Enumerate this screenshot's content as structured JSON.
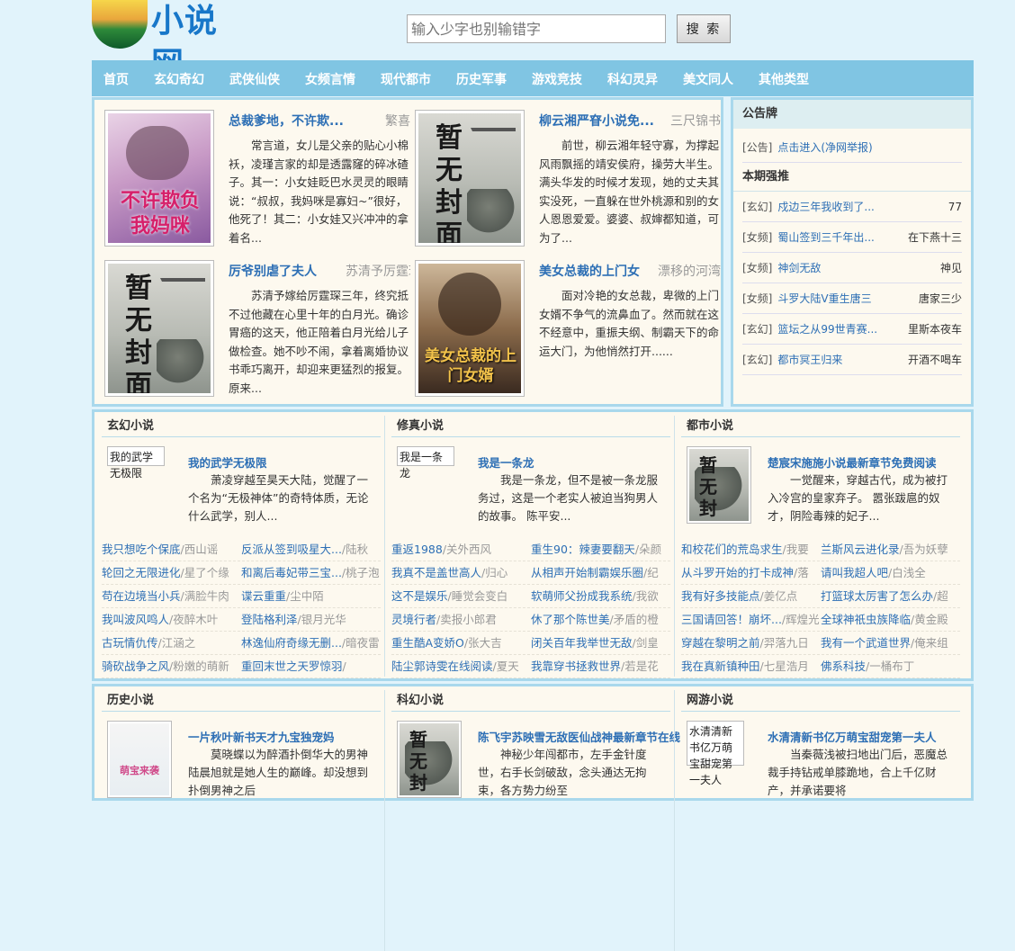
{
  "site": {
    "logo_text": "小说网"
  },
  "search": {
    "placeholder": "输入少字也别输错字",
    "button_label": "搜 索"
  },
  "nav": [
    "首页",
    "玄幻奇幻",
    "武侠仙侠",
    "女频言情",
    "现代都市",
    "历史军事",
    "游戏竞技",
    "科幻灵异",
    "美文同人",
    "其他类型"
  ],
  "featured": [
    {
      "title": "总裁爹地，不许欺...",
      "author": "繁喜",
      "desc": "常言道，女儿是父亲的贴心小棉袄，凌瑾言家的却是透露窿的碎冰碴子。其一：小女娃眨巴水灵灵的眼睛说：“叔叔，我妈咪是寡妇~”很好，他死了！其二：小女娃又兴冲冲的拿着名...",
      "cover_text": "不许欺负我妈咪"
    },
    {
      "title": "柳云湘严眘小说免...",
      "author": "三尺锦书",
      "desc": "前世，柳云湘年轻守寡，为撑起风雨飘摇的靖安侯府，操劳大半生。满头华发的时候才发现，她的丈夫其实没死，一直躲在世外桃源和别的女人恩恩爱爱。婆婆、叔婶都知道，可为了...",
      "cover_text": "暂无封面"
    },
    {
      "title": "厉爷别虐了夫人",
      "author": "苏清予厉霆琛",
      "desc": "苏清予嫁给厉霆琛三年，终究抵不过他藏在心里十年的白月光。确诊胃癌的这天，他正陪着白月光给儿子做检查。她不吵不闹，拿着离婚协议书乖巧离开，却迎来更猛烈的报复。 原来...",
      "cover_text": "暂无封面"
    },
    {
      "title": "美女总裁的上门女",
      "author": "漂移的河湾",
      "desc": "面对冷艳的女总裁，卑微的上门女婿不争气的流鼻血了。然而就在这不经意中，重振夫纲、制霸天下的命运大门，为他悄然打开......",
      "cover_text": "美女总裁的上门女婿"
    }
  ],
  "sidebar": {
    "notice_title": "公告牌",
    "notice": {
      "cat": "[公告]",
      "text": "点击进入(净网举报)"
    },
    "rank_title": "本期强推",
    "rank": [
      {
        "cat": "[玄幻]",
        "name": "戍边三年我收到了...",
        "author": "77"
      },
      {
        "cat": "[女频]",
        "name": "蜀山签到三千年出...",
        "author": "在下燕十三"
      },
      {
        "cat": "[女频]",
        "name": "神剑无敌",
        "author": "神见"
      },
      {
        "cat": "[女频]",
        "name": "斗罗大陆V重生唐三",
        "author": "唐家三少"
      },
      {
        "cat": "[玄幻]",
        "name": "篮坛之从99世青赛...",
        "author": "里斯本夜车"
      },
      {
        "cat": "[玄幻]",
        "name": "都市冥王归来",
        "author": "开酒不喝车"
      }
    ]
  },
  "sections1": [
    {
      "heading": "玄幻小说",
      "top_title": "我的武学无极限",
      "top_desc": "萧凌穿越至昊天大陆，觉醒了一个名为“无极神体”的奇特体质，无论什么武学，别人...",
      "cover_text": "我的武学无极限",
      "rows": [
        [
          "我只想吃个保底",
          "西山谣",
          "反派从签到吸星大...",
          "陆秋"
        ],
        [
          "轮回之无限进化",
          "星了个缘",
          "和离后毒妃带三宝...",
          "桃子泡"
        ],
        [
          "苟在边境当小兵",
          "满脸牛肉",
          "谍云重重",
          "尘中陌"
        ],
        [
          "我叫波风鸣人",
          "夜醉木叶",
          "登陆格利泽",
          "银月光华"
        ],
        [
          "古玩情仇传",
          "江涵之",
          "林逸仙府奇缘无删...",
          "暗夜雷"
        ],
        [
          "骑砍战争之风",
          "粉嫩的萌新",
          "重回末世之天罗惊羽",
          ""
        ]
      ]
    },
    {
      "heading": "修真小说",
      "top_title": "我是一条龙",
      "top_desc": "我是一条龙，但不是被一条龙服务过，这是一个老实人被迫当狗男人的故事。 陈平安...",
      "cover_text": "我是一条龙",
      "rows": [
        [
          "重返1988",
          "关外西风",
          "重生90：辣妻要翻天",
          "朵颜"
        ],
        [
          "我真不是盖世高人",
          "归心",
          "从相声开始制霸娱乐圈",
          "纪"
        ],
        [
          "这不是娱乐",
          "睡觉会变白",
          "软萌师父扮成我系统",
          "我欲"
        ],
        [
          "灵境行者",
          "卖报小郎君",
          "休了那个陈世美",
          "矛盾的橙"
        ],
        [
          "重生酷A变娇O",
          "张大吉",
          "闭关百年我举世无敌",
          "剑皇"
        ],
        [
          "陆尘郭诗雯在线阅读",
          "夏天",
          "我靠穿书拯救世界",
          "若是花"
        ]
      ]
    },
    {
      "heading": "都市小说",
      "top_title": "楚宸宋施施小说最新章节免费阅读",
      "top_desc": "一觉醒来，穿越古代，成为被打入冷宫的皇家弃子。 嚣张跋扈的奴才，阴险毒辣的妃子...",
      "cover_text": "暂无封面",
      "rows": [
        [
          "和校花们的荒岛求生",
          "我要",
          "兰斯风云进化录",
          "吾为妖孽"
        ],
        [
          "从斗罗开始的打卡成神",
          "落",
          "请叫我超人吧",
          "白浅全"
        ],
        [
          "我有好多技能点",
          "姜亿点",
          "打篮球太厉害了怎么办",
          "超"
        ],
        [
          "三国请回答！崩坏...",
          "辉煌光",
          "全球神祇虫族降临",
          "黄金殿"
        ],
        [
          "穿越在黎明之前",
          "羿落九日",
          "我有一个武道世界",
          "俺来组"
        ],
        [
          "我在真新镇种田",
          "七星浩月",
          "佛系科技",
          "一桶布丁"
        ]
      ]
    }
  ],
  "sections2": [
    {
      "heading": "历史小说",
      "top_title": "一片秋叶新书天才九宝独宠妈",
      "top_desc": "莫晓蝶以为醉酒扑倒华大的男神陆晨旭就是她人生的巅峰。却没想到扑倒男神之后",
      "cover_text": "萌宝来袭"
    },
    {
      "heading": "科幻小说",
      "top_title": "陈飞宇苏映雪无敌医仙战神最新章节在线",
      "top_desc": "神秘少年闯都市，左手金针度世，右手长剑破敌，念头通达无拘束，各方势力纷至",
      "cover_text": "暂无封面"
    },
    {
      "heading": "网游小说",
      "top_title": "水清清新书亿万萌宝甜宠第一夫人",
      "top_desc": "当秦薇浅被扫地出门后，恶魔总裁手持钻戒单膝跪地，合上千亿财产，并承诺要将",
      "cover_text": "水清清新书亿万萌宝甜宠第一夫人"
    }
  ],
  "colors": {
    "nav_bg": "#80c5e3",
    "link": "#2d6fb5",
    "page_bg": "#e1f3fb",
    "panel_bg": "#fdf9ef"
  }
}
